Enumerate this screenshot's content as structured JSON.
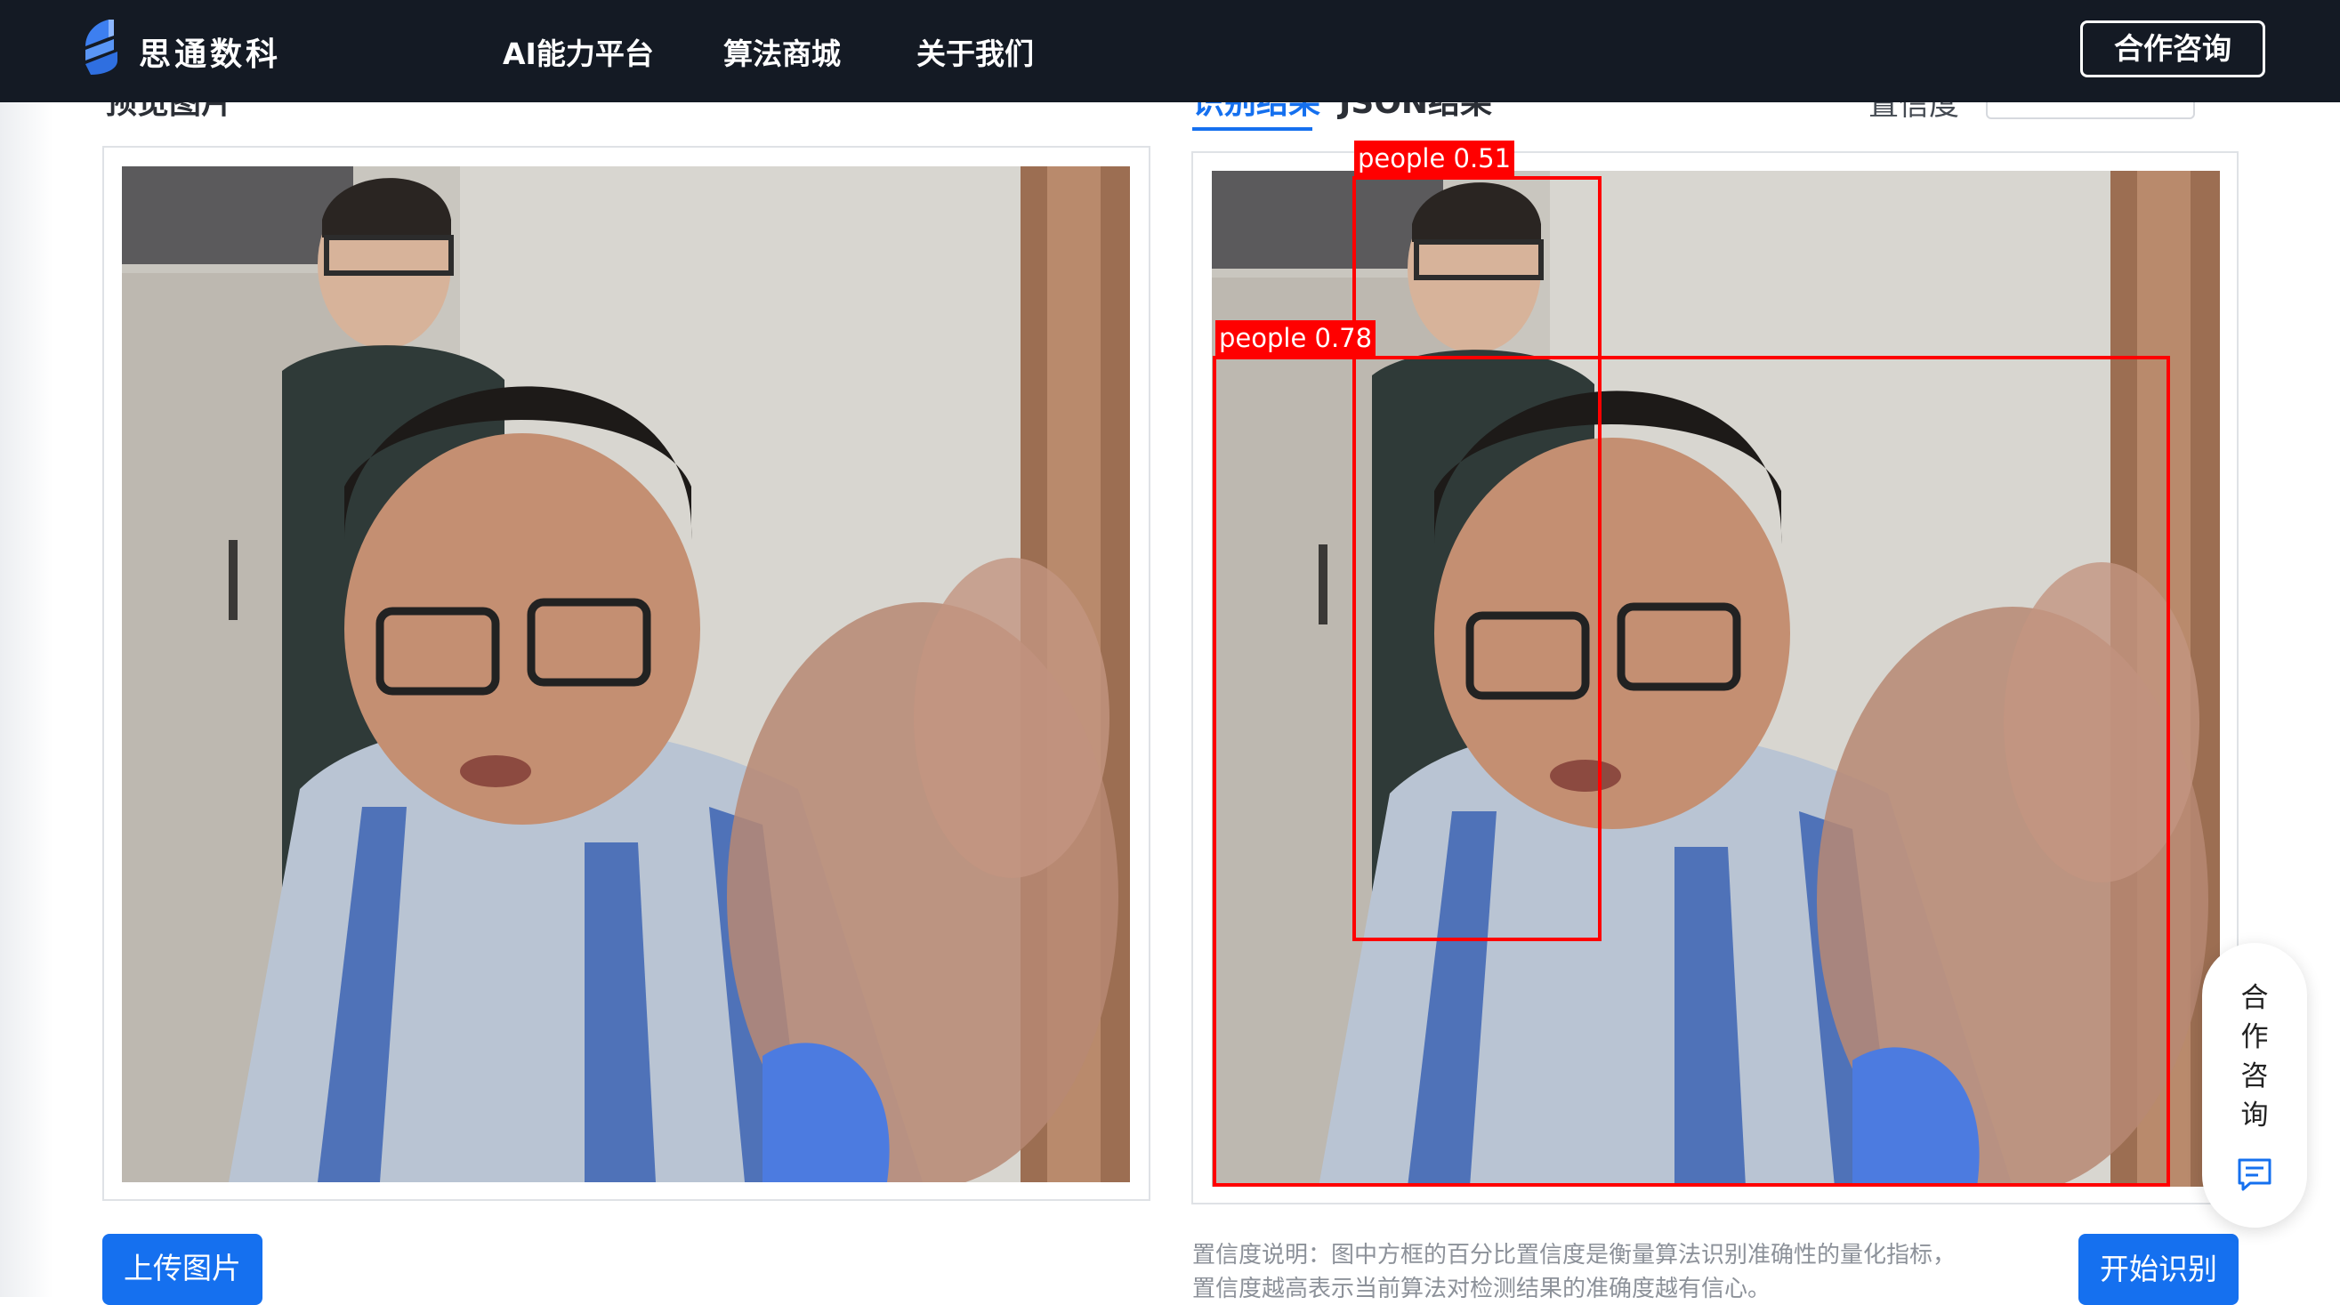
{
  "navbar": {
    "brand": "思通数科",
    "items": [
      "AI能力平台",
      "算法商城",
      "关于我们"
    ],
    "consult_button": "合作咨询"
  },
  "left_panel": {
    "heading": "预览图片",
    "upload_button": "上传图片"
  },
  "right_panel": {
    "tabs": [
      {
        "label": "识别结果",
        "active": true
      },
      {
        "label": "JSON结果",
        "active": false
      }
    ],
    "confidence_label": "置信度",
    "close_icon": "×",
    "detections": [
      {
        "label": "people 0.51"
      },
      {
        "label": "people 0.78"
      }
    ],
    "note_line1": "置信度说明：图中方框的百分比置信度是衡量算法识别准确性的量化指标，",
    "note_line2": "置信度越高表示当前算法对检测结果的准确度越有信心。",
    "start_button": "开始识别"
  },
  "float_widget": {
    "chars": [
      "合",
      "作",
      "咨",
      "询"
    ],
    "icon": "chat-icon"
  },
  "colors": {
    "navbar_bg": "#141a24",
    "primary": "#1570ef",
    "detection": "#ff0000"
  }
}
